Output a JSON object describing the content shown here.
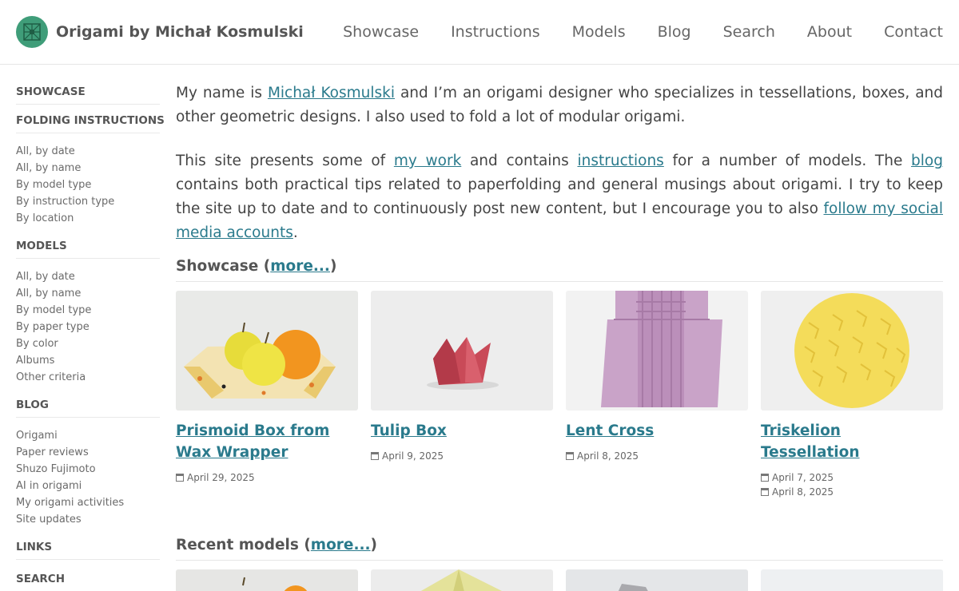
{
  "header": {
    "site_title": "Origami by Michał Kosmulski",
    "nav": [
      "Showcase",
      "Instructions",
      "Models",
      "Blog",
      "Search",
      "About",
      "Contact"
    ]
  },
  "sidebar": {
    "showcase": "SHOWCASE",
    "folding": {
      "title": "FOLDING INSTRUCTIONS",
      "items": [
        "All, by date",
        "All, by name",
        "By model type",
        "By instruction type",
        "By location"
      ]
    },
    "models": {
      "title": "MODELS",
      "items": [
        "All, by date",
        "All, by name",
        "By model type",
        "By paper type",
        "By color",
        "Albums",
        "Other criteria"
      ]
    },
    "blog": {
      "title": "BLOG",
      "items": [
        "Origami",
        "Paper reviews",
        "Shuzo Fujimoto",
        "AI in origami",
        "My origami activities",
        "Site updates"
      ]
    },
    "links": "LINKS",
    "search": "SEARCH"
  },
  "intro": {
    "p1_a": "My name is ",
    "p1_link": "Michał Kosmulski",
    "p1_b": " and I’m an origami designer who specializes in tessellations, boxes, and other geometric designs. I also used to fold a lot of modular origami.",
    "p2_a": "This site presents some of ",
    "p2_link1": "my work",
    "p2_b": " and contains ",
    "p2_link2": "instructions",
    "p2_c": " for a number of models. The ",
    "p2_link3": "blog",
    "p2_d": " contains both practical tips related to paperfolding and general musings about origami. I try to keep the site up to date and to continuously post new content, but I encourage you to also ",
    "p2_link4": "follow my social media accounts",
    "p2_e": "."
  },
  "showcase": {
    "title": "Showcase (",
    "more": "more...",
    "close": ")",
    "cards": [
      {
        "title": "Prismoid Box from Wax Wrapper",
        "dates": [
          "April 29, 2025"
        ]
      },
      {
        "title": "Tulip Box",
        "dates": [
          "April 9, 2025"
        ]
      },
      {
        "title": "Lent Cross",
        "dates": [
          "April 8, 2025"
        ]
      },
      {
        "title": "Triskelion Tessellation",
        "dates": [
          "April 7, 2025",
          "April 8, 2025"
        ]
      }
    ]
  },
  "recent": {
    "title": "Recent models (",
    "more": "more...",
    "close": ")"
  }
}
